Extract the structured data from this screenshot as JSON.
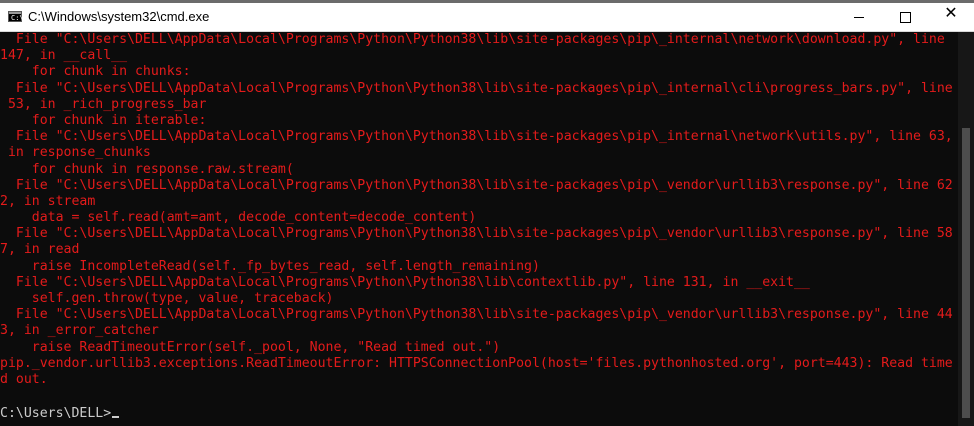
{
  "window": {
    "title": "C:\\Windows\\system32\\cmd.exe",
    "icon": "cmd-icon",
    "icon_glyph": "C:\\",
    "controls": {
      "minimize": "minimize-icon",
      "maximize": "maximize-icon",
      "close": "close-icon",
      "close_glyph": "✕"
    }
  },
  "console": {
    "text_color": "#e41b1b",
    "prompt_color": "#cccccc",
    "background": "#0c0c0c",
    "lines": [
      "  File \"C:\\Users\\DELL\\AppData\\Local\\Programs\\Python\\Python38\\lib\\site-packages\\pip\\_internal\\network\\download.py\", line",
      "147, in __call__",
      "    for chunk in chunks:",
      "  File \"C:\\Users\\DELL\\AppData\\Local\\Programs\\Python\\Python38\\lib\\site-packages\\pip\\_internal\\cli\\progress_bars.py\", line",
      " 53, in _rich_progress_bar",
      "    for chunk in iterable:",
      "  File \"C:\\Users\\DELL\\AppData\\Local\\Programs\\Python\\Python38\\lib\\site-packages\\pip\\_internal\\network\\utils.py\", line 63,",
      " in response_chunks",
      "    for chunk in response.raw.stream(",
      "  File \"C:\\Users\\DELL\\AppData\\Local\\Programs\\Python\\Python38\\lib\\site-packages\\pip\\_vendor\\urllib3\\response.py\", line 62",
      "2, in stream",
      "    data = self.read(amt=amt, decode_content=decode_content)",
      "  File \"C:\\Users\\DELL\\AppData\\Local\\Programs\\Python\\Python38\\lib\\site-packages\\pip\\_vendor\\urllib3\\response.py\", line 58",
      "7, in read",
      "    raise IncompleteRead(self._fp_bytes_read, self.length_remaining)",
      "  File \"C:\\Users\\DELL\\AppData\\Local\\Programs\\Python\\Python38\\lib\\contextlib.py\", line 131, in __exit__",
      "    self.gen.throw(type, value, traceback)",
      "  File \"C:\\Users\\DELL\\AppData\\Local\\Programs\\Python\\Python38\\lib\\site-packages\\pip\\_vendor\\urllib3\\response.py\", line 44",
      "3, in _error_catcher",
      "    raise ReadTimeoutError(self._pool, None, \"Read timed out.\")",
      "pip._vendor.urllib3.exceptions.ReadTimeoutError: HTTPSConnectionPool(host='files.pythonhosted.org', port=443): Read time",
      "d out."
    ],
    "prompt": "C:\\Users\\DELL>"
  }
}
